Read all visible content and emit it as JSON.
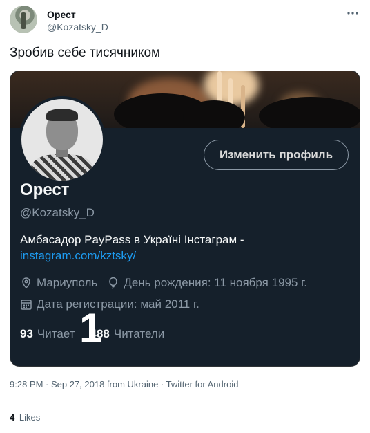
{
  "tweet": {
    "author_name": "Орест",
    "author_handle": "@Kozatsky_D",
    "more_icon": "more-icon",
    "text": "Зробив себе тисячником",
    "timestamp": "9:28 PM · Sep 27, 2018 from Ukraine · Twitter for Android",
    "likes_count": "4",
    "likes_label": "Likes"
  },
  "profile_card": {
    "name": "Орест",
    "handle": "@Kozatsky_D",
    "edit_button": "Изменить профиль",
    "bio_text": "Амбасадор PayPass в Україні  Інстаграм -",
    "bio_link": "instagram.com/kztsky/",
    "location": "Мариуполь",
    "birthday": "День рождения: 11 ноября 1995 г.",
    "joined": "Дата регистрации: май 2011 г.",
    "following_count": "93",
    "following_label": "Читает",
    "followers_count": "1488",
    "followers_prefix": "1",
    "followers_rest": "488",
    "followers_label": "Читатели"
  },
  "colors": {
    "card_bg": "#15202b",
    "link": "#1d9bf0",
    "muted": "#8b98a5"
  }
}
